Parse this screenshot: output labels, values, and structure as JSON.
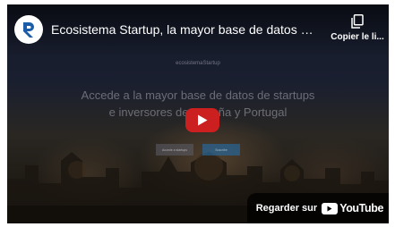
{
  "video": {
    "title": "Ecosistema Startup, la mayor base de datos de startups e inversores de España y Portugal",
    "channel_avatar_letter": "R",
    "copy_link_label": "Copier le li..."
  },
  "thumbnail": {
    "site_brand": "ecosistemaStartup",
    "headline": "Accede a la mayor base de datos de startups e inversores de España y Portugal",
    "cta_primary": "Accede a startups",
    "cta_secondary": "Suscribe"
  },
  "watch_on": {
    "label": "Regarder sur",
    "platform": "YouTube"
  },
  "icons": {
    "avatar": "channel-logo-r",
    "copy": "copy-icon",
    "play": "play-icon",
    "platform": "youtube-logo-icon"
  },
  "colors": {
    "play_button": "#cc1f1f",
    "avatar_letter": "#1b5ba8",
    "text": "#ffffff"
  }
}
